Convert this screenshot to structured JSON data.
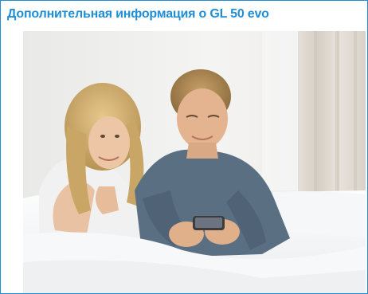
{
  "panel": {
    "title": "Дополнительная информация о GL 50 evo",
    "accent_color": "#1f8ed6"
  },
  "photo": {
    "icon": "photo-image"
  }
}
